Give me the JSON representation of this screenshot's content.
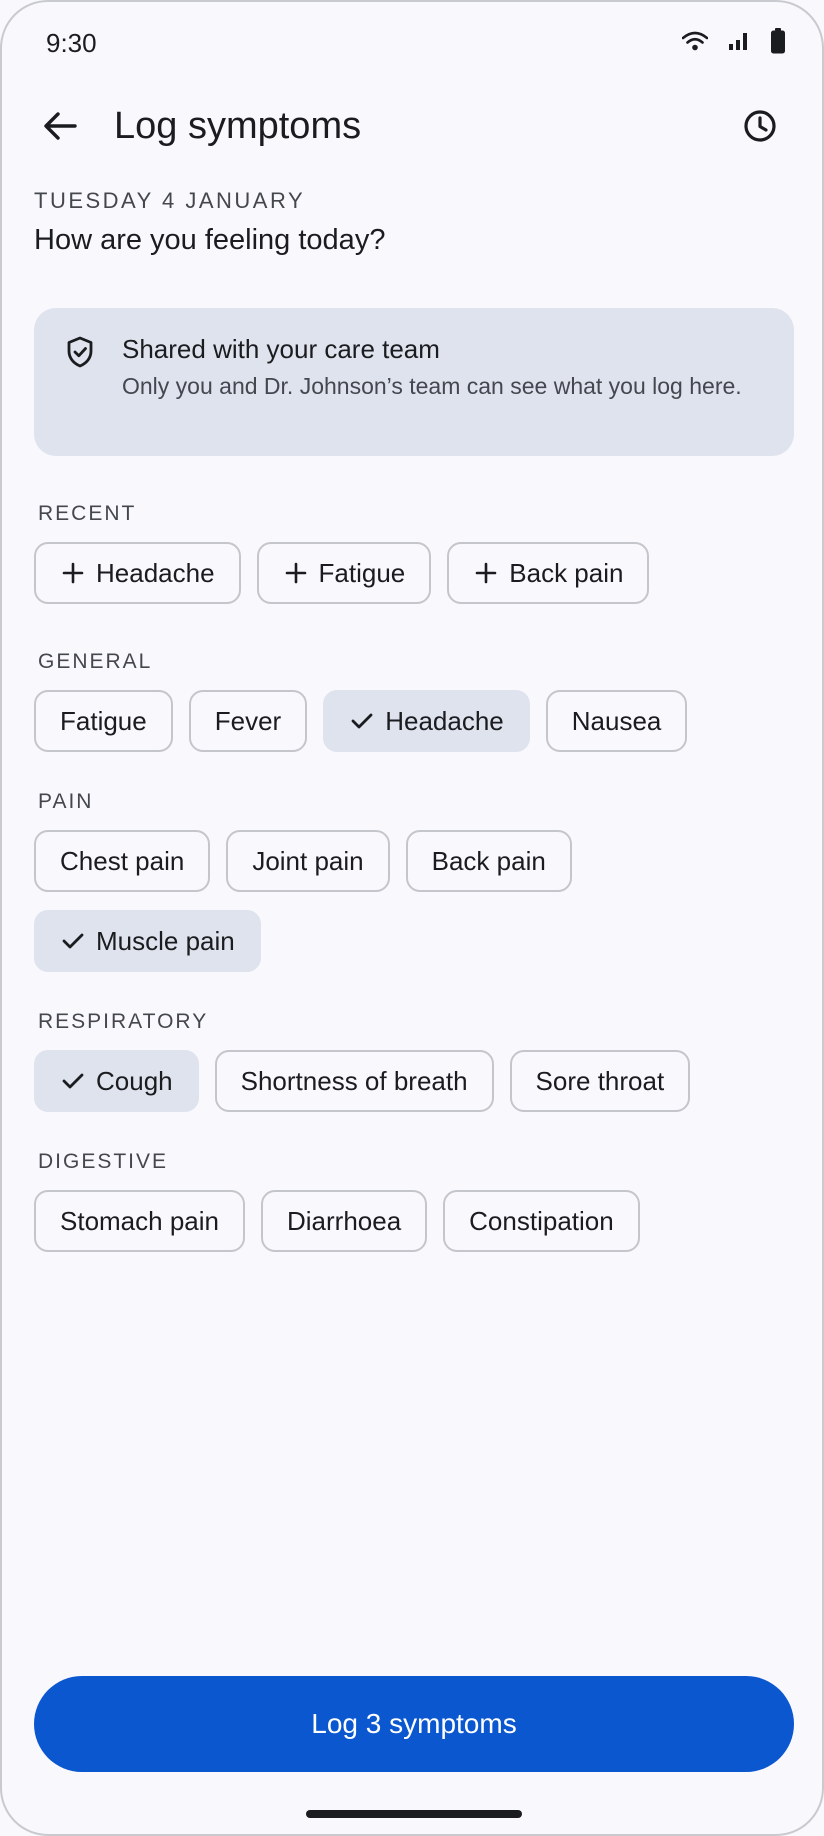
{
  "status": {
    "time": "9:30"
  },
  "header": {
    "title": "Log symptoms"
  },
  "date_label": "TUESDAY 4 JANUARY",
  "question": "How are you feeling today?",
  "info": {
    "title": "Shared with your care team",
    "body": "Only you and Dr. Johnson’s team can see what you log here."
  },
  "sections": {
    "recent": {
      "label": "RECENT",
      "items": [
        "Headache",
        "Fatigue",
        "Back pain"
      ]
    },
    "general": {
      "label": "GENERAL",
      "items": [
        "Fatigue",
        "Fever",
        "Headache",
        "Nausea"
      ],
      "selected": [
        "Headache"
      ]
    },
    "pain": {
      "label": "PAIN",
      "items": [
        "Chest pain",
        "Joint pain",
        "Back pain",
        "Muscle pain"
      ],
      "selected": [
        "Muscle pain"
      ]
    },
    "respiratory": {
      "label": "RESPIRATORY",
      "items": [
        "Cough",
        "Shortness of breath",
        "Sore throat"
      ],
      "selected": [
        "Cough"
      ]
    },
    "digestive": {
      "label": "DIGESTIVE",
      "items": [
        "Stomach pain",
        "Diarrhoea",
        "Constipation"
      ]
    }
  },
  "primary_button": {
    "label": "Log 3 symptoms"
  },
  "icons": {
    "back": "arrow-back-icon",
    "history": "clock-icon",
    "info": "shield-check-icon",
    "add": "plus-icon",
    "selected": "check-icon",
    "wifi": "wifi-icon",
    "signal": "cell-signal-icon",
    "battery": "battery-icon"
  },
  "colors": {
    "primary": "#0b57d0",
    "selected_chip": "#dfe3ee",
    "background": "#f9f9fd"
  }
}
